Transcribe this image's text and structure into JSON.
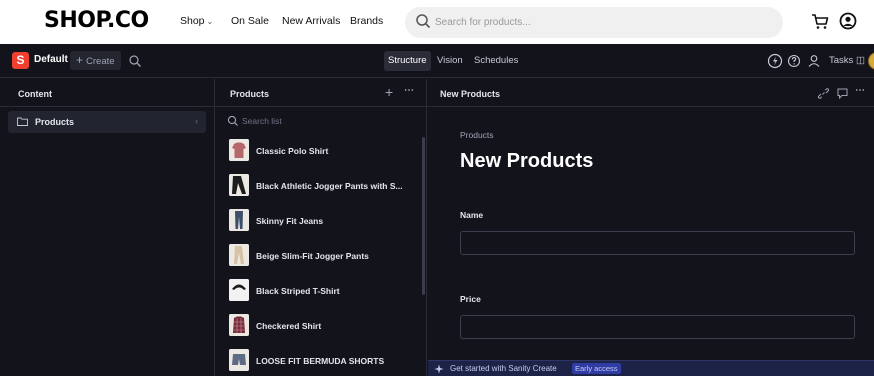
{
  "storefront": {
    "logo": "SHOP.CO",
    "nav": [
      {
        "label": "Shop",
        "has_dropdown": true
      },
      {
        "label": "On Sale",
        "has_dropdown": false
      },
      {
        "label": "New Arrivals",
        "has_dropdown": false
      },
      {
        "label": "Brands",
        "has_dropdown": false
      }
    ],
    "search_placeholder": "Search for products...",
    "icons": [
      "search-icon",
      "cart-icon",
      "account-icon"
    ]
  },
  "studio": {
    "workspace_badge": "S",
    "workspace_name": "Default",
    "create_label": "Create",
    "tools": [
      {
        "label": "Structure",
        "active": true
      },
      {
        "label": "Vision",
        "active": false
      },
      {
        "label": "Schedules",
        "active": false
      }
    ],
    "tasks_label": "Tasks",
    "accent_color": "#f03e2f"
  },
  "content_pane": {
    "title": "Content",
    "items": [
      {
        "label": "Products"
      }
    ]
  },
  "products_pane": {
    "title": "Products",
    "search_placeholder": "Search list",
    "items": [
      {
        "name": "Classic Polo Shirt"
      },
      {
        "name": "Black Athletic Jogger Pants with S..."
      },
      {
        "name": "Skinny Fit Jeans"
      },
      {
        "name": "Beige Slim-Fit Jogger Pants"
      },
      {
        "name": "Black Striped T-Shirt"
      },
      {
        "name": "Checkered Shirt"
      },
      {
        "name": "LOOSE FIT BERMUDA SHORTS"
      }
    ]
  },
  "document_pane": {
    "header_title": "New Products",
    "breadcrumb": "Products",
    "title": "New Products",
    "fields": [
      {
        "label": "Name",
        "value": ""
      },
      {
        "label": "Price",
        "value": ""
      }
    ]
  },
  "promo": {
    "text": "Get started with Sanity Create",
    "badge": "Early access"
  }
}
